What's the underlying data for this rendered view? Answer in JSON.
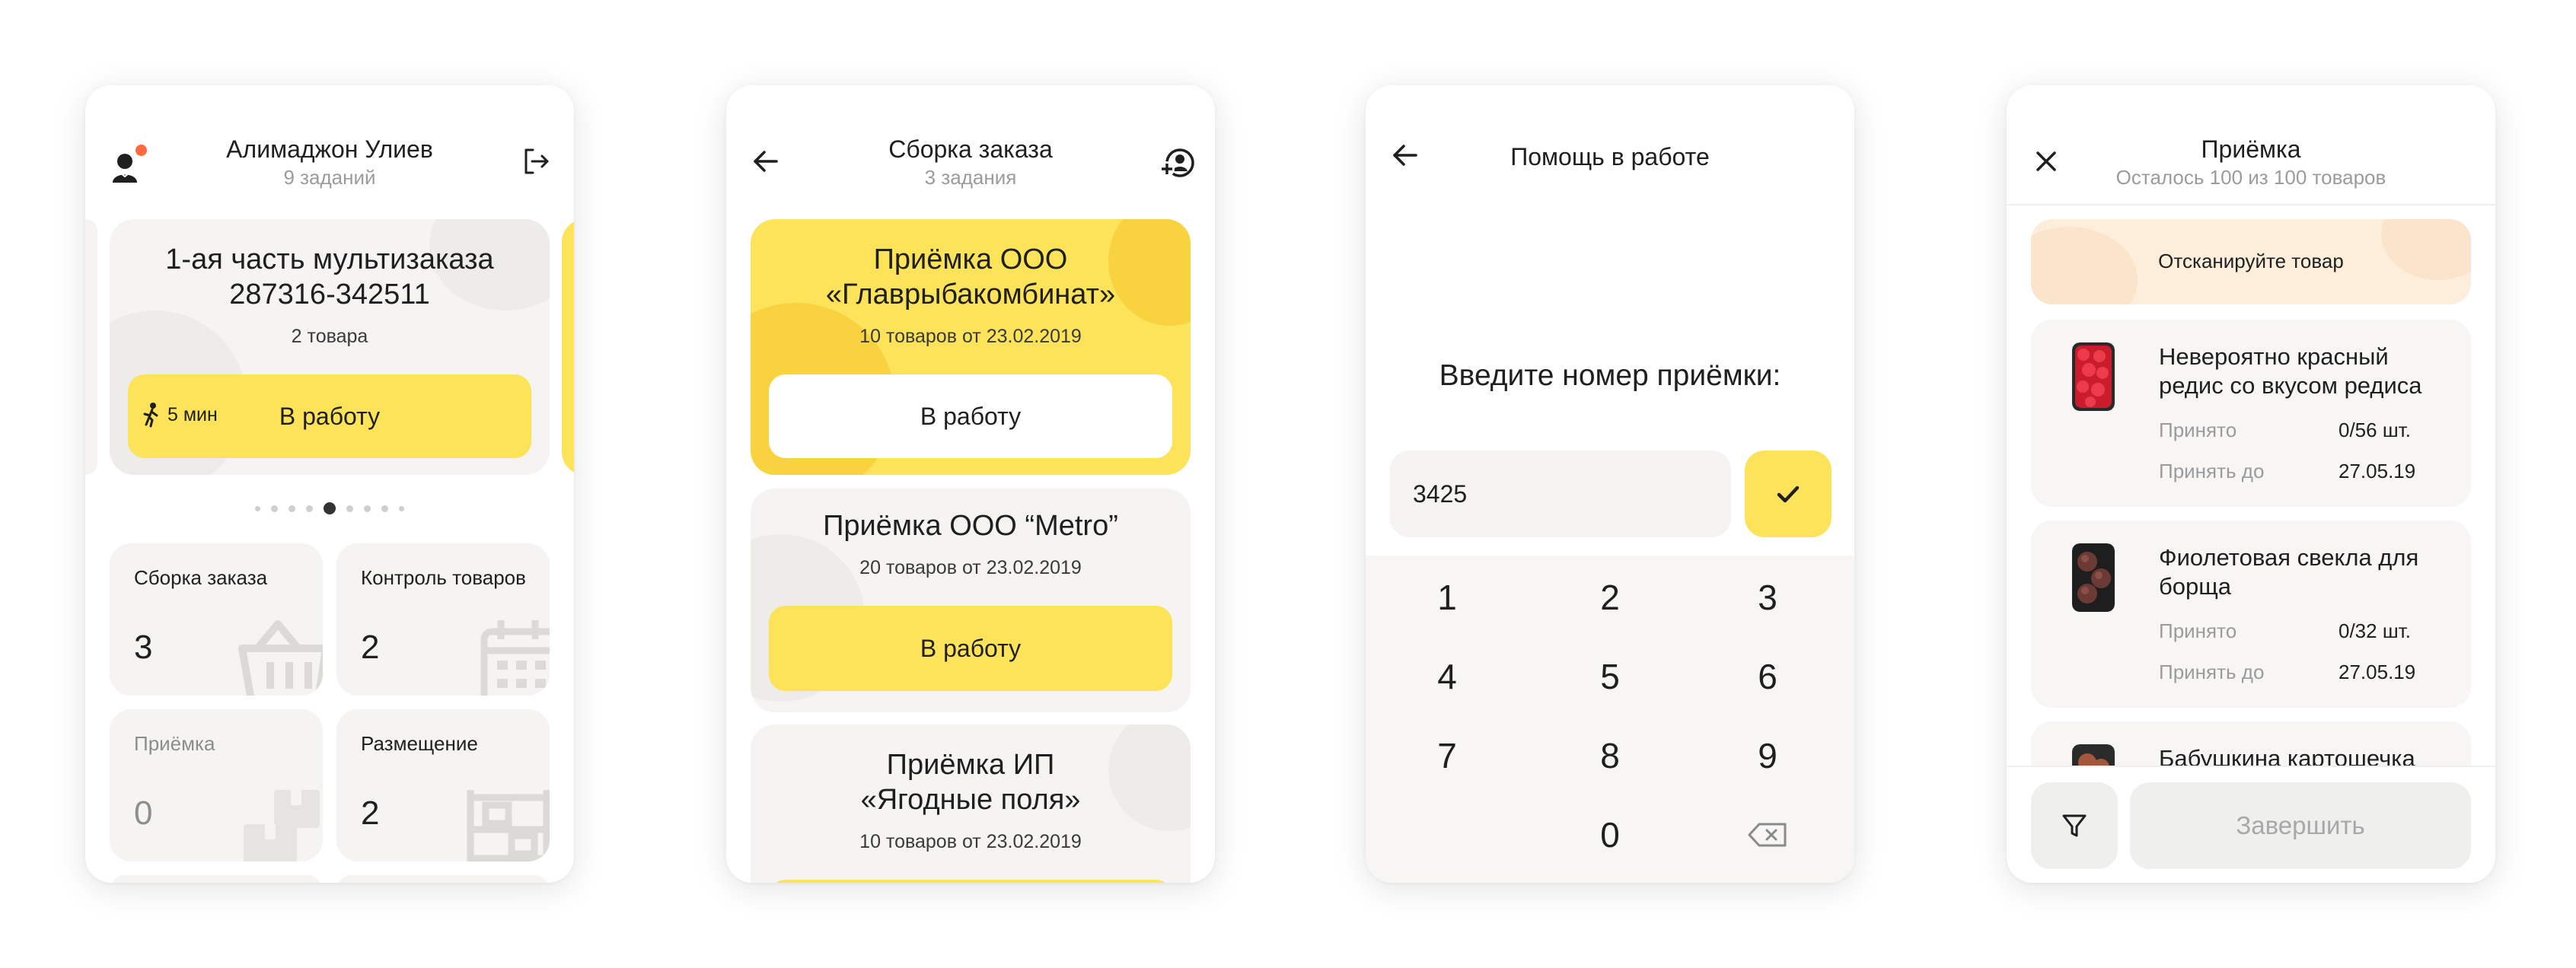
{
  "screen1": {
    "user_name": "Алимаджон Улиев",
    "tasks_count": "9 заданий",
    "card": {
      "title_line1": "1-ая часть мультизаказа",
      "title_line2": "287316-342511",
      "subtitle": "2 товара",
      "time": "5 мин",
      "button": "В работу"
    },
    "carousel": {
      "total": 9,
      "active_index": 4
    },
    "tiles": [
      {
        "label": "Сборка заказа",
        "count": "3"
      },
      {
        "label": "Контроль товаров",
        "count": "2"
      },
      {
        "label": "Приёмка",
        "count": "0"
      },
      {
        "label": "Размещение",
        "count": "2"
      }
    ]
  },
  "screen2": {
    "title": "Сборка заказа",
    "subtitle": "3 задания",
    "orders": [
      {
        "title_line1": "Приёмка ООО",
        "title_line2": "«Главрыбакомбинат»",
        "subtitle": "10 товаров от 23.02.2019",
        "button": "В работу"
      },
      {
        "title_line1": "Приёмка ООО “Metro”",
        "subtitle": "20 товаров от 23.02.2019",
        "button": "В работу"
      },
      {
        "title_line1": "Приёмка ИП",
        "title_line2": "«Ягодные поля»",
        "subtitle": "10 товаров от 23.02.2019"
      }
    ]
  },
  "screen3": {
    "title": "Помощь в работе",
    "prompt": "Введите номер приёмки:",
    "input_value": "3425",
    "keys": [
      "1",
      "2",
      "3",
      "4",
      "5",
      "6",
      "7",
      "8",
      "9",
      "0"
    ]
  },
  "screen4": {
    "title": "Приёмка",
    "subtitle": "Осталось 100 из 100 товаров",
    "banner": "Отсканируйте товар",
    "items": [
      {
        "name": "Невероятно красный редис со вкусом редиса",
        "accepted_label": "Принято",
        "accepted_value": "0/56 шт.",
        "deadline_label": "Принять до",
        "deadline_value": "27.05.19"
      },
      {
        "name": "Фиолетовая свекла для борща",
        "accepted_label": "Принято",
        "accepted_value": "0/32 шт.",
        "deadline_label": "Принять до",
        "deadline_value": "27.05.19"
      },
      {
        "name": "Бабушкина картошечка"
      }
    ],
    "finish_button": "Завершить"
  },
  "colors": {
    "accent_yellow": "#fce35a",
    "card_gray": "#f5f4f2",
    "notification_dot": "#ff6a3d",
    "banner_peach": "#fdeedc"
  },
  "icons": [
    "courier-avatar-icon",
    "logout-icon",
    "back-arrow-icon",
    "add-user-icon",
    "check-icon",
    "backspace-icon",
    "close-icon",
    "filter-icon",
    "walking-person-icon",
    "basket-icon",
    "calendar-icon",
    "box-icon",
    "shelves-icon"
  ]
}
